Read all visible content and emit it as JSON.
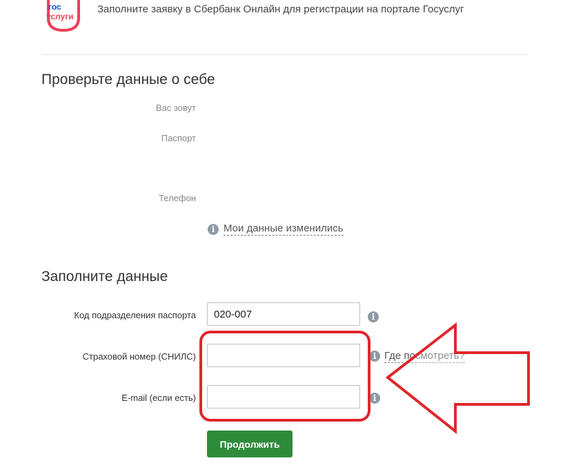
{
  "header": {
    "logo": {
      "line1": "гос",
      "line2": "услуги"
    },
    "text": "Заполните заявку в Сбербанк Онлайн для регистрации на портале Госуслуг"
  },
  "check_section": {
    "title": "Проверьте данные о себе",
    "rows": [
      {
        "label": "Вас зовут"
      },
      {
        "label": "Паспорт"
      },
      {
        "label": "Телефон"
      }
    ],
    "changed_link": "Мои данные изменились"
  },
  "fill_section": {
    "title": "Заполните данные",
    "fields": [
      {
        "label": "Код подразделения паспорта",
        "value": "020-007"
      },
      {
        "label": "Страховой номер (СНИЛС)",
        "value": "",
        "help_link": "Где посмотреть?"
      },
      {
        "label": "E-mail (если есть)",
        "value": ""
      }
    ],
    "continue_label": "Продолжить"
  },
  "colors": {
    "accent_green": "#2e8b3a",
    "highlight_red": "#e0262c",
    "logo_blue": "#0d4cd3",
    "logo_red": "#ee3f58",
    "info_icon": "#8f9aa3"
  },
  "icons": [
    "gosuslugi-logo",
    "info-icon",
    "red-arrow-annotation"
  ]
}
